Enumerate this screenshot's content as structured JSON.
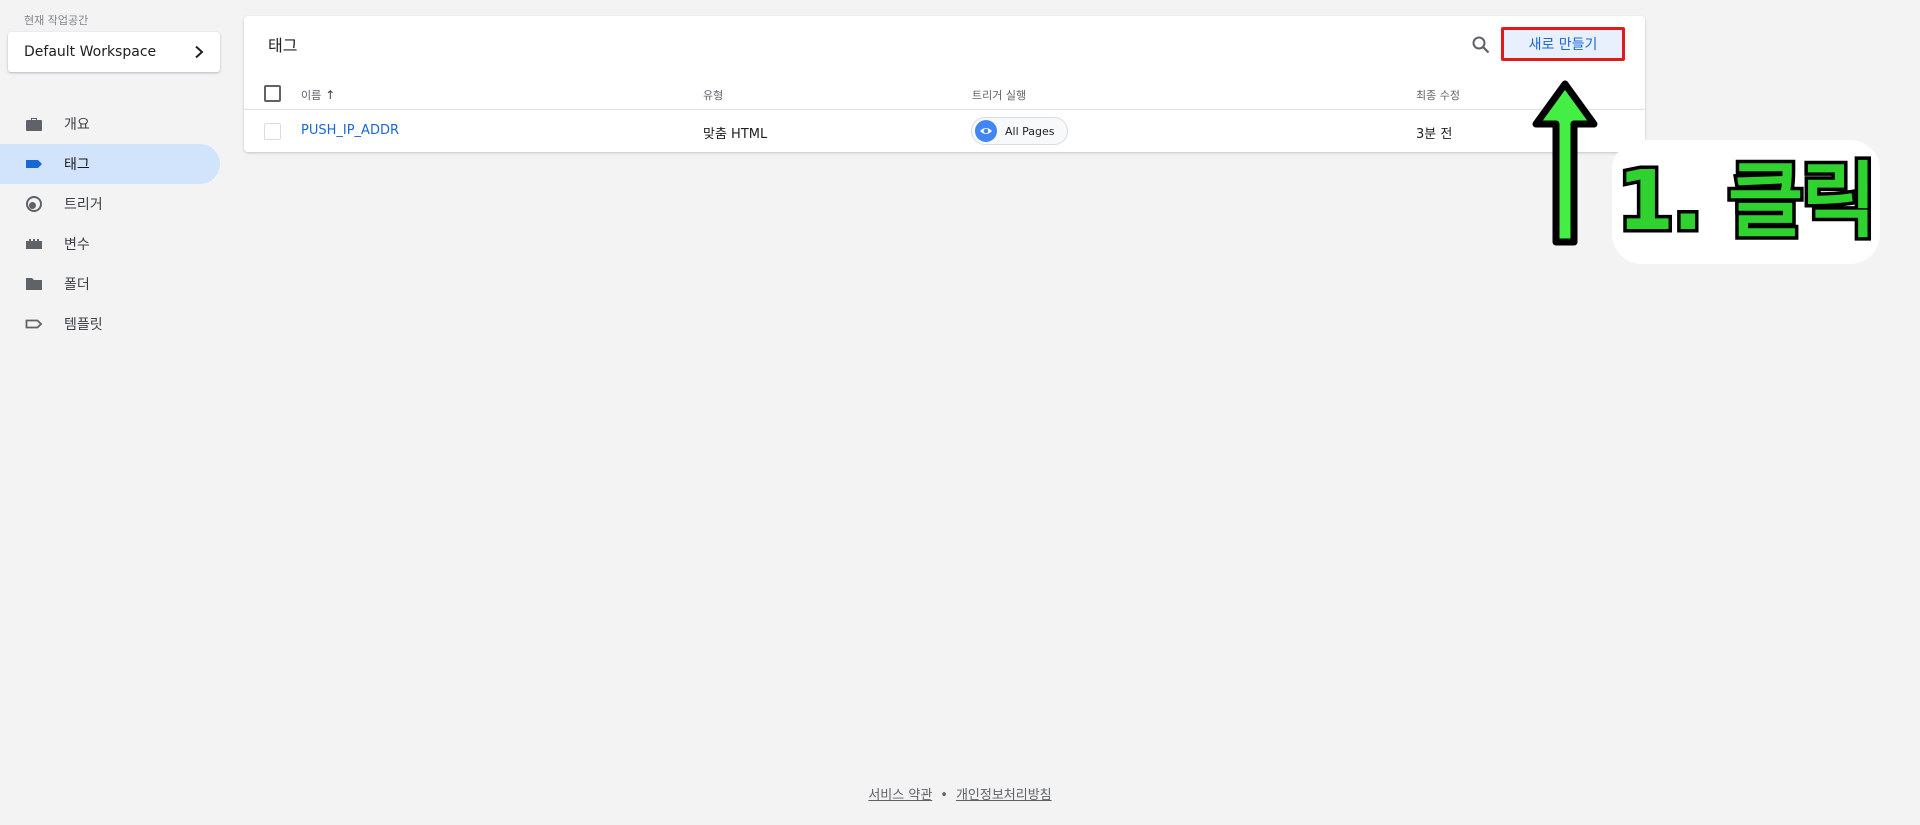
{
  "sidebar": {
    "workspace_label": "현재 작업공간",
    "workspace_name": "Default Workspace",
    "items": [
      {
        "label": "개요",
        "icon": "briefcase-icon",
        "active": false
      },
      {
        "label": "태그",
        "icon": "tag-icon",
        "active": true
      },
      {
        "label": "트리거",
        "icon": "trigger-icon",
        "active": false
      },
      {
        "label": "변수",
        "icon": "variables-icon",
        "active": false
      },
      {
        "label": "폴더",
        "icon": "folder-icon",
        "active": false
      },
      {
        "label": "템플릿",
        "icon": "template-icon",
        "active": false
      }
    ]
  },
  "main": {
    "title": "태그",
    "new_button": "새로 만들기",
    "columns": {
      "name": "이름",
      "type": "유형",
      "trigger": "트리거 실행",
      "modified": "최종 수정"
    },
    "rows": [
      {
        "name": "PUSH_IP_ADDR",
        "type": "맞춤 HTML",
        "trigger": "All Pages",
        "modified": "3분 전"
      }
    ]
  },
  "annotation": {
    "text": "1. 클릭",
    "arrow_color": "#44ee44",
    "highlight_color": "#e31a1a"
  },
  "footer": {
    "terms": "서비스 약관",
    "separator": "•",
    "privacy": "개인정보처리방침"
  },
  "colors": {
    "accent": "#1967d2",
    "active_nav_bg": "#d2e3fc",
    "page_bg": "#f3f3f4"
  }
}
